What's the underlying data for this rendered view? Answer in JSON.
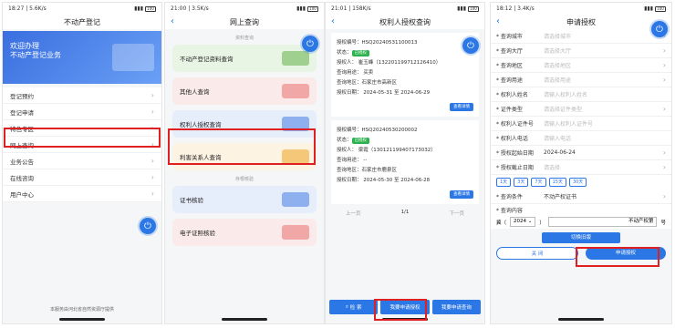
{
  "phone1": {
    "status_time": "18:27 | 5.6K/s",
    "status_batt": "100",
    "title": "不动产登记",
    "banner_line1": "欢迎办理",
    "banner_line2": "不动产登记业务",
    "menu": [
      "登记预约",
      "登记申请",
      "特色专区",
      "网上查询",
      "业务公告",
      "在线咨询",
      "用户中心"
    ],
    "footer": "本服务由河北省自然资源厅提供"
  },
  "phone2": {
    "status_time": "21:00 | 3.5K/s",
    "status_batt": "100",
    "title": "网上查询",
    "section1": "资料查询",
    "cards1": [
      "不动产登记资料查询",
      "其他人查询",
      "权利人授权查询",
      "利害关系人查询"
    ],
    "section2": "存根核验",
    "cards2": [
      "证书核验",
      "电子证照核验"
    ]
  },
  "phone3": {
    "status_time": "21:01 | 158K/s",
    "status_batt": "100",
    "title": "权利人授权查询",
    "records": [
      {
        "no": "授权编号：HSQ20240531100013",
        "state_label": "状态：",
        "state": "已授权",
        "person": "授权人：  崔玉峰（1322011997121264​10）",
        "purpose": "查询用途：  买卖",
        "area": "查询地区：石家庄市高新区",
        "date": "授权日期：  2024-05-31 至 2024-06-29",
        "detail": "查看详情"
      },
      {
        "no": "授权编号：HSQ20240530200002",
        "state_label": "状态：",
        "state": "已授权",
        "person": "授权人：  梁霞（130121199407173032）",
        "purpose": "查询用途：  --",
        "area": "查询地区：石家庄市鹿泉区",
        "date": "授权日期：  2024-05-30 至 2024-06-28",
        "detail": "查看详情"
      }
    ],
    "pager": [
      "上一页",
      "1/1",
      "下一页"
    ],
    "buttons": [
      "检 索",
      "我要申请授权",
      "我要申请查询"
    ]
  },
  "phone4": {
    "status_time": "18:12 | 3.4K/s",
    "status_batt": "100",
    "title": "申请授权",
    "fields": [
      {
        "label": "* 查询城市",
        "value": "请选择城市",
        "set": false,
        "chev": true
      },
      {
        "label": "* 查询大厅",
        "value": "请选择大厅",
        "set": false,
        "chev": true
      },
      {
        "label": "* 查询地区",
        "value": "请选择地区",
        "set": false,
        "chev": true
      },
      {
        "label": "* 查询用途",
        "value": "请选择用途",
        "set": false,
        "chev": true
      },
      {
        "label": "* 权利人姓名",
        "value": "请输入权利人姓名",
        "set": false,
        "chev": false
      },
      {
        "label": "* 证件类型",
        "value": "请选择证件类型",
        "set": false,
        "chev": true
      },
      {
        "label": "* 权利人证件号",
        "value": "请输入权利人证件号",
        "set": false,
        "chev": false
      },
      {
        "label": "* 权利人电话",
        "value": "请输入电话",
        "set": false,
        "chev": false
      },
      {
        "label": "* 授权起始日期",
        "value": "2024-06-24",
        "set": true,
        "chev": true
      },
      {
        "label": "* 授权截止日期",
        "value": "请选择",
        "set": false,
        "chev": true
      }
    ],
    "chips": [
      "1天",
      "3天",
      "7天",
      "15天",
      "30天"
    ],
    "condition_label": "* 查询条件",
    "condition_value": "不动产权证书",
    "content_label": "* 查询内容",
    "year_prefix": "冀（",
    "year_value": "2024",
    "year_suffix": "）",
    "year_input": "不动产权第",
    "year_end": "号",
    "switch_btn": "切换旧版",
    "close_btn": "关 闭",
    "apply_btn": "申请授权"
  }
}
